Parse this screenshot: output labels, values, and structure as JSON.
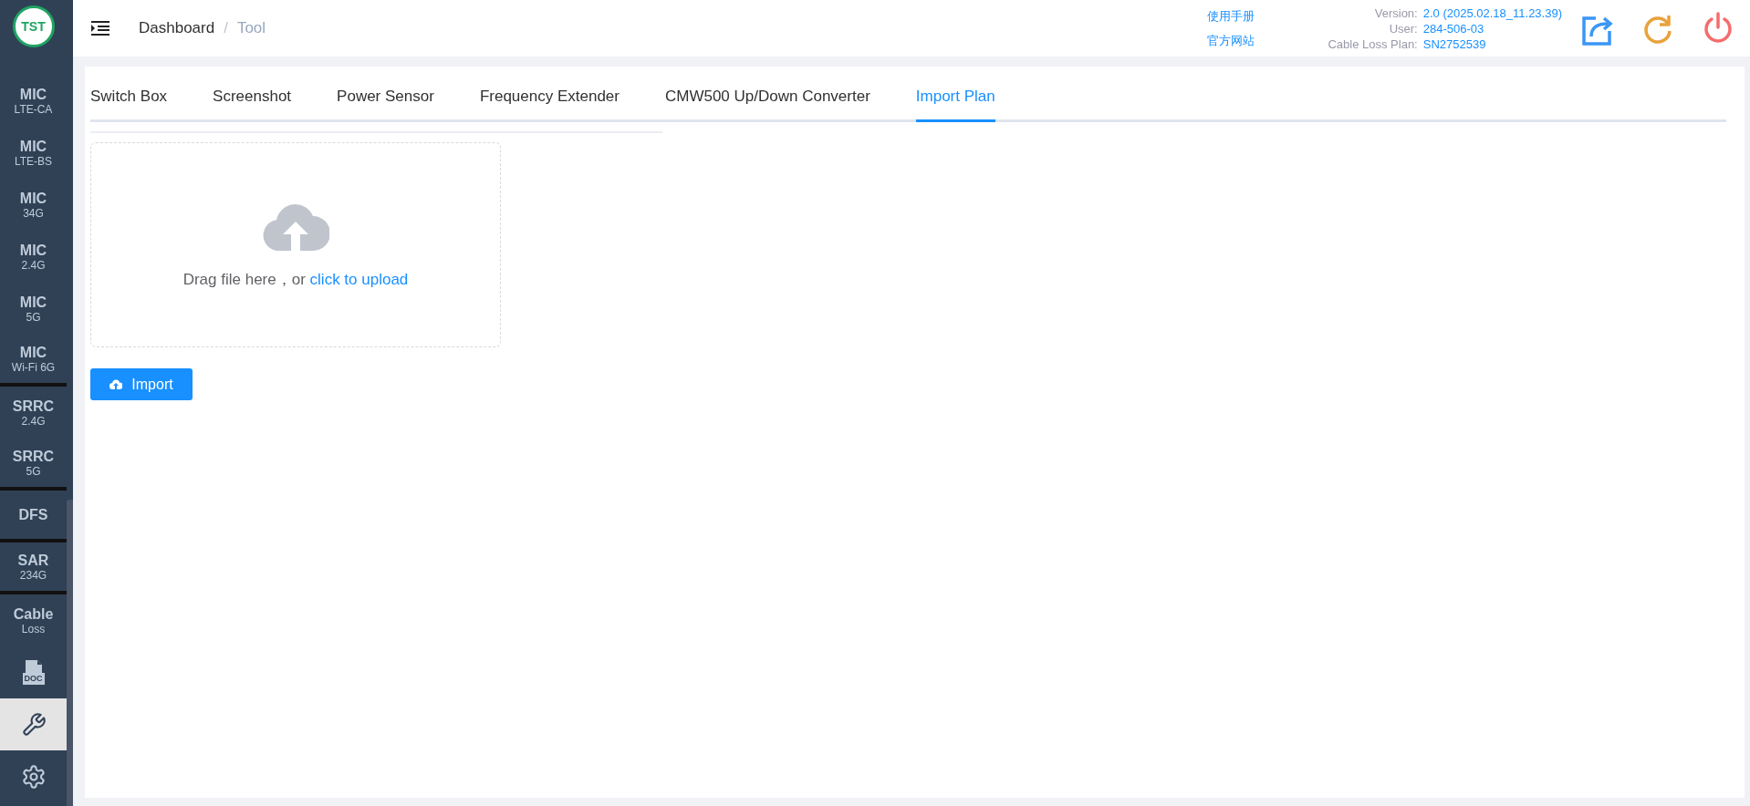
{
  "logo": {
    "text": "TST"
  },
  "sidebar": {
    "items": [
      {
        "kind": "text",
        "title": "MIC",
        "subtitle": "LTE-CA",
        "selected": false,
        "divider_after": false
      },
      {
        "kind": "text",
        "title": "MIC",
        "subtitle": "LTE-BS",
        "selected": false,
        "divider_after": false
      },
      {
        "kind": "text",
        "title": "MIC",
        "subtitle": "34G",
        "selected": false,
        "divider_after": false
      },
      {
        "kind": "text",
        "title": "MIC",
        "subtitle": "2.4G",
        "selected": false,
        "divider_after": false
      },
      {
        "kind": "text",
        "title": "MIC",
        "subtitle": "5G",
        "selected": false,
        "divider_after": false
      },
      {
        "kind": "text",
        "title": "MIC",
        "subtitle": "Wi-Fi 6G",
        "selected": false,
        "divider_after": true
      },
      {
        "kind": "text",
        "title": "SRRC",
        "subtitle": "2.4G",
        "selected": false,
        "divider_after": false
      },
      {
        "kind": "text",
        "title": "SRRC",
        "subtitle": "5G",
        "selected": false,
        "divider_after": true
      },
      {
        "kind": "text",
        "title": "DFS",
        "selected": false,
        "divider_after": true
      },
      {
        "kind": "text",
        "title": "SAR",
        "subtitle": "234G",
        "selected": false,
        "divider_after": true
      },
      {
        "kind": "text",
        "title": "Cable",
        "subtitle": "Loss",
        "selected": false,
        "divider_after": false
      },
      {
        "kind": "doc",
        "label": "DOC",
        "selected": false,
        "divider_after": false
      },
      {
        "kind": "wrench",
        "selected": true,
        "divider_after": false
      },
      {
        "kind": "gear",
        "selected": false,
        "divider_after": false
      }
    ]
  },
  "header": {
    "breadcrumb": [
      "Dashboard",
      "Tool"
    ],
    "breadcrumb_separator": "/",
    "links": [
      "使用手册",
      "官方网站"
    ],
    "info": [
      {
        "label": "Version:",
        "value": "2.0 (2025.02.18_11.23.39)"
      },
      {
        "label": "User:",
        "value": "284-506-03"
      },
      {
        "label": "Cable Loss Plan:",
        "value": "SN2752539"
      }
    ]
  },
  "tabs": [
    {
      "label": "Switch Box",
      "selected": false
    },
    {
      "label": "Screenshot",
      "selected": false
    },
    {
      "label": "Power Sensor",
      "selected": false
    },
    {
      "label": "Frequency Extender",
      "selected": false
    },
    {
      "label": "CMW500 Up/Down Converter",
      "selected": false
    },
    {
      "label": "Import Plan",
      "selected": true
    }
  ],
  "upload": {
    "text": "Drag file here，or",
    "link": "click to upload"
  },
  "import_button": {
    "label": "Import"
  }
}
